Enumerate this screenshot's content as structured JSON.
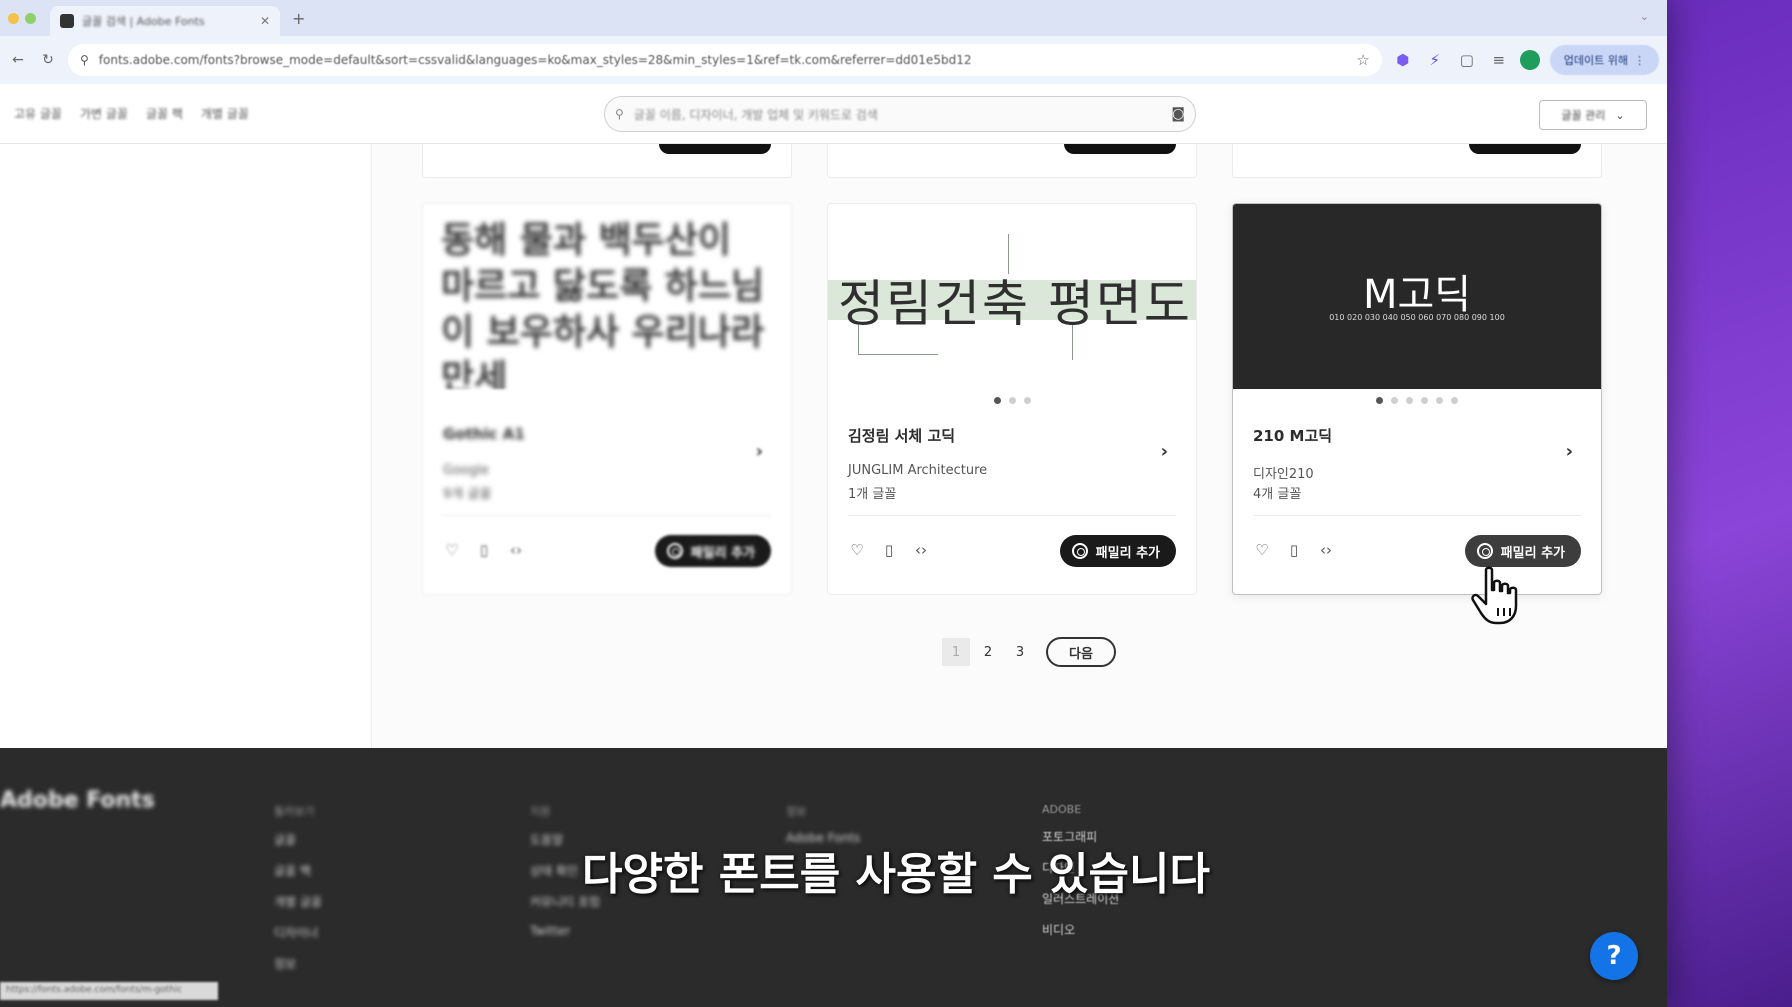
{
  "browser": {
    "tab_title": "글꼴 검색 | Adobe Fonts",
    "url": "fonts.adobe.com/fonts?browse_mode=default&sort=cssvalid&languages=ko&max_styles=28&min_styles=1&ref=tk.com&referrer=dd01e5bd12",
    "update_label": "업데이트 위해"
  },
  "site": {
    "nav": [
      "고유 글꼴",
      "가변 글꼴",
      "글꼴 팩",
      "개별 글꼴"
    ],
    "search_placeholder": "글꼴 이름, 디자이너, 개발 업체 및 키워드로 검색",
    "manage_label": "글꼴 관리"
  },
  "cards": [
    {
      "preview_text": "동해 물과 백두산이 마르고 닳도록 하느님이 보우하사 우리나라 만세",
      "name": "Gothic A1",
      "foundry": "Google",
      "count": "9개 글꼴",
      "button": "패밀리 추가"
    },
    {
      "preview_text": "정림건축 평면도",
      "name": "김정림 서체 고딕",
      "foundry": "JUNGLIM Architecture",
      "count": "1개 글꼴",
      "button": "패밀리 추가"
    },
    {
      "preview_text": "M고딕",
      "preview_sub": "010 020 030 040 050 060 070 080 090 100",
      "name": "210 M고딕",
      "foundry": "디자인210",
      "count": "4개 글꼴",
      "button": "패밀리 추가"
    }
  ],
  "pagination": {
    "pages": [
      "1",
      "2",
      "3"
    ],
    "current": "1",
    "next_label": "다음"
  },
  "footer": {
    "logo": "Adobe Fonts",
    "columns": [
      {
        "head": "둘러보기",
        "items": [
          "글꼴",
          "글꼴 팩",
          "개별 글꼴",
          "디자이너",
          "정보"
        ]
      },
      {
        "head": "지원",
        "items": [
          "도움말",
          "상태 확인",
          "커뮤니티 포럼",
          "Twitter"
        ]
      },
      {
        "head": "정보",
        "items": [
          "Adobe Fonts"
        ]
      },
      {
        "head": "ADOBE",
        "items": [
          "포토그래피",
          "디자인",
          "일러스트레이션",
          "비디오"
        ]
      }
    ]
  },
  "subtitle": "다양한 폰트를 사용할 수 있습니다",
  "help_label": "?",
  "status_text": "https://fonts.adobe.com/fonts/m-gothic"
}
